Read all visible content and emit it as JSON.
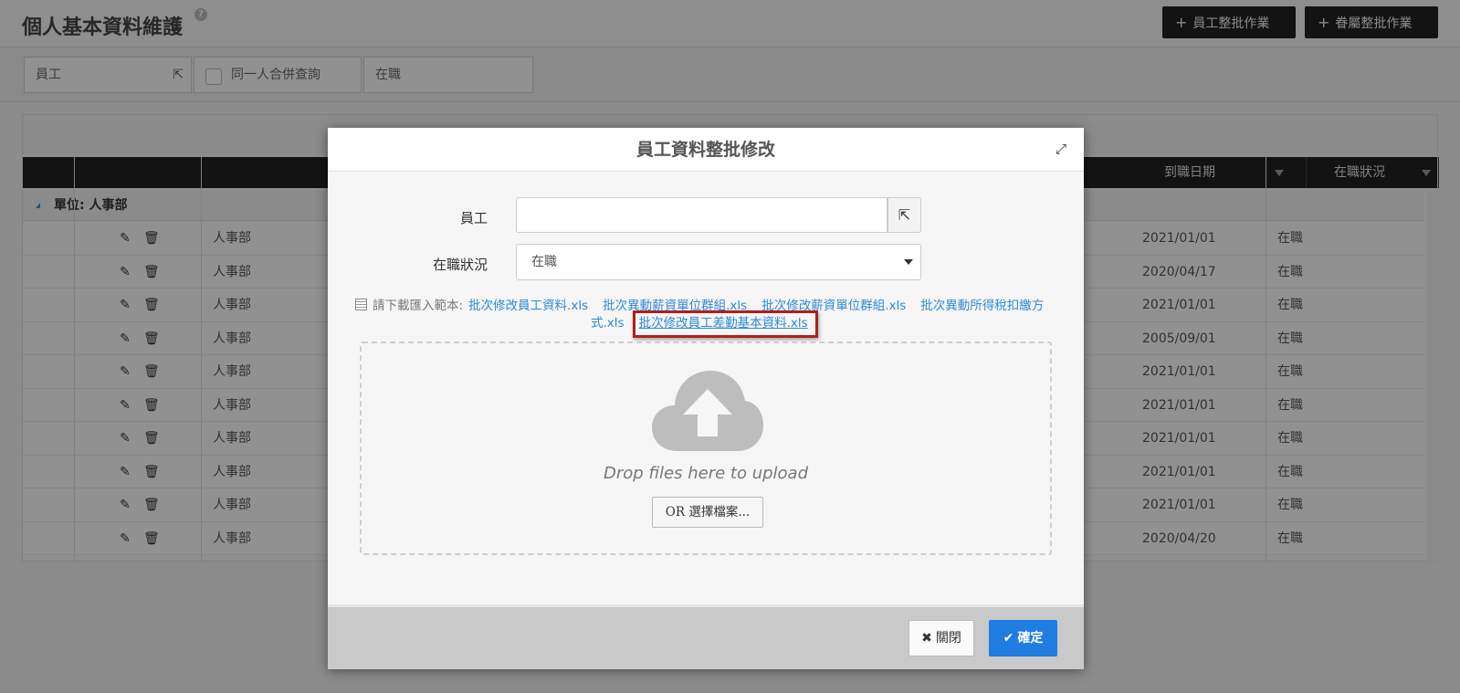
{
  "page": {
    "title": "個人基本資料維護",
    "help_icon": "?",
    "batch_buttons": [
      {
        "plus": "+",
        "label": "員工整批作業",
        "caret": "▼"
      },
      {
        "plus": "+",
        "label": "眷屬整批作業",
        "caret": "▼"
      }
    ],
    "filters": {
      "employee": "員工",
      "merge_query": "同一人合併查詢",
      "status": "在職"
    },
    "grid": {
      "headers": {
        "date": "到職日期",
        "status": "在職狀況"
      },
      "group_label": "單位: 人事部",
      "rows": [
        {
          "dept": "人事部",
          "date": "2021/01/01",
          "status": "在職"
        },
        {
          "dept": "人事部",
          "date": "2020/04/17",
          "status": "在職"
        },
        {
          "dept": "人事部",
          "date": "2021/01/01",
          "status": "在職"
        },
        {
          "dept": "人事部",
          "date": "2005/09/01",
          "status": "在職"
        },
        {
          "dept": "人事部",
          "date": "2021/01/01",
          "status": "在職"
        },
        {
          "dept": "人事部",
          "date": "2021/01/01",
          "status": "在職"
        },
        {
          "dept": "人事部",
          "date": "2021/01/01",
          "status": "在職"
        },
        {
          "dept": "人事部",
          "date": "2021/01/01",
          "status": "在職"
        },
        {
          "dept": "人事部",
          "date": "2021/01/01",
          "status": "在職"
        },
        {
          "dept": "人事部",
          "date": "2020/04/20",
          "status": "在職"
        }
      ]
    }
  },
  "modal": {
    "title": "員工資料整批修改",
    "employee_label": "員工",
    "employee_value": "",
    "status_label": "在職狀況",
    "status_value": "在職",
    "template_prefix": "請下載匯入範本:",
    "templates": [
      "批次修改員工資料.xls",
      "批次異動薪資單位群組.xls",
      "批次修改薪資單位群組.xls",
      "批次異動所得稅扣繳方式.xls",
      "批次修改員工差勤基本資料.xls"
    ],
    "template_4_part1": "批次異動所得稅扣繳方",
    "template_4_part2": "式.xls",
    "drop_text": "Drop files here to upload",
    "choose_button": "OR 選擇檔案...",
    "close_button": "關閉",
    "ok_button": "確定"
  },
  "colors": {
    "accent": "#1f7ce0",
    "link": "#2c8ad6",
    "highlight": "#b01e1e",
    "header_dark": "#222222"
  },
  "icons": [
    "help-icon",
    "plus-icon",
    "external-link-icon",
    "expand-icon",
    "edit-icon",
    "trash-icon",
    "document-icon",
    "cloud-upload-icon",
    "close-icon",
    "check-icon",
    "dropdown-caret-icon",
    "filter-icon"
  ]
}
